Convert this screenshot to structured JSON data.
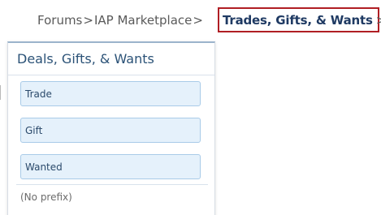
{
  "breadcrumb": {
    "items": [
      "Forums",
      "IAP Marketplace"
    ],
    "separator": ">",
    "active": "Trades, Gifts, & Wants",
    "highlight_color": "#b01e24"
  },
  "menu": {
    "title": "Deals, Gifts, & Wants",
    "options": [
      "Trade",
      "Gift",
      "Wanted"
    ],
    "no_prefix": "(No prefix)"
  }
}
